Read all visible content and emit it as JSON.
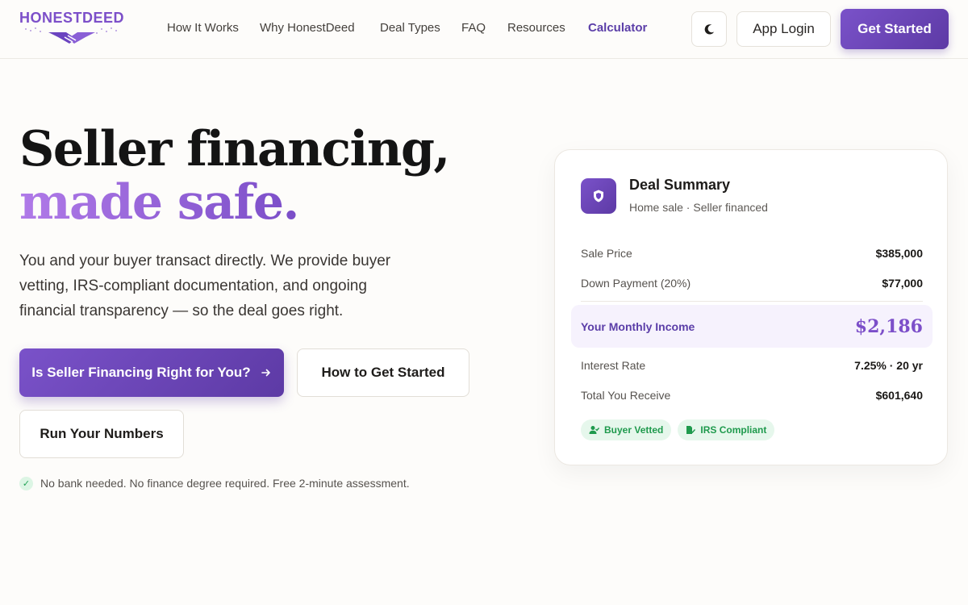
{
  "brand": {
    "name": "HONESTDEED",
    "accent": "#7c4fc9"
  },
  "nav": {
    "items": [
      {
        "label": "How It Works"
      },
      {
        "label": "Why HonestDeed"
      },
      {
        "label": "Deal Types"
      },
      {
        "label": "FAQ"
      },
      {
        "label": "Resources"
      },
      {
        "label": "Calculator",
        "active": true
      }
    ],
    "theme_toggle_icon": "moon-icon",
    "login_label": "App Login",
    "get_started_label": "Get Started"
  },
  "hero": {
    "title_line1": "Seller financing,",
    "title_line2": "made safe.",
    "subtitle": "You and your buyer transact directly. We provide buyer vetting, IRS-compliant documentation, and ongoing financial transparency — so the deal goes right.",
    "cta_primary": "Is Seller Financing Right for You?",
    "cta_primary_icon": "arrow-right-icon",
    "cta_secondary": "How to Get Started",
    "cta_tertiary": "Run Your Numbers",
    "assurance": "No bank needed. No finance degree required. Free 2-minute assessment.",
    "assurance_icon": "check-icon"
  },
  "summary": {
    "icon": "shield-icon",
    "title": "Deal Summary",
    "subtitle": "Home sale · Seller financed",
    "sale_price_label": "Sale Price",
    "sale_price": "$385,000",
    "down_payment_label": "Down Payment (20%)",
    "down_payment": "$77,000",
    "monthly_income_label": "Your Monthly Income",
    "monthly_income": "$2,186",
    "interest_rate_label": "Interest Rate",
    "interest_rate": "7.25% · 20 yr",
    "total_label": "Total You Receive",
    "total": "$601,640",
    "badges": [
      {
        "label": "Buyer Vetted",
        "icon": "user-check-icon"
      },
      {
        "label": "IRS Compliant",
        "icon": "document-icon"
      }
    ]
  }
}
